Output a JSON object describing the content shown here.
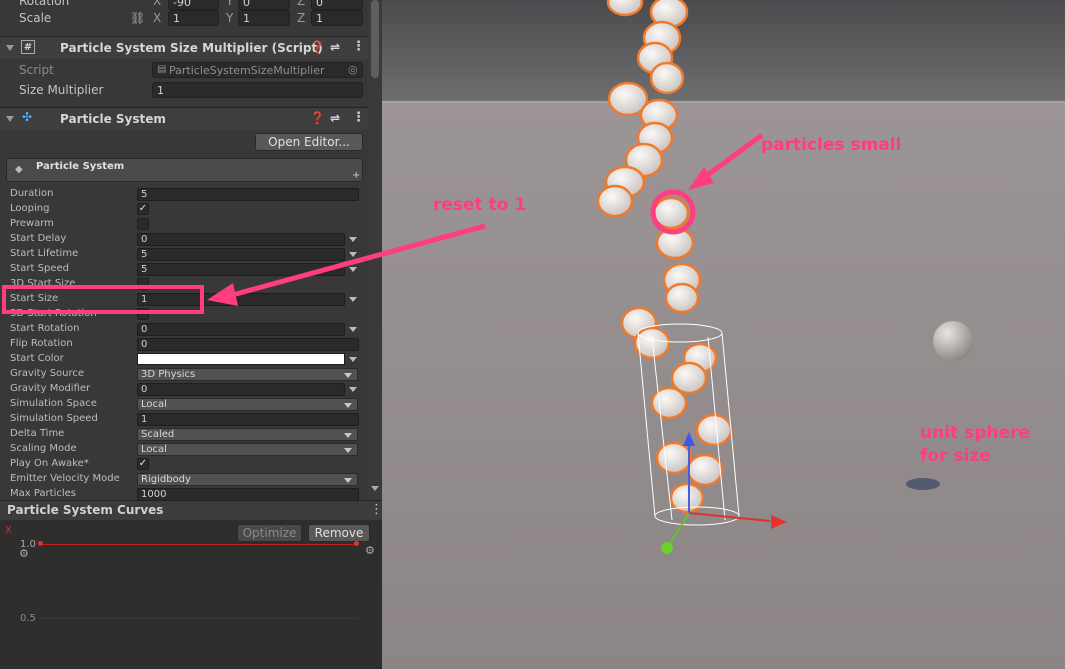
{
  "transform": {
    "rotation_label": "Rotation",
    "rotation_x": "-90",
    "rotation_y": "0",
    "rotation_z": "0",
    "scale_label": "Scale",
    "scale_x": "1",
    "scale_y": "1",
    "scale_z": "1",
    "x": "X",
    "y": "Y",
    "z": "Z"
  },
  "size_script": {
    "title": "Particle System Size Multiplier (Script)",
    "script_label": "Script",
    "script_value": "ParticleSystemSizeMultiplier",
    "multiplier_label": "Size Multiplier",
    "multiplier_value": "1"
  },
  "particle_component": {
    "title": "Particle System",
    "open_editor": "Open Editor...",
    "module_title": "Particle System"
  },
  "props": {
    "duration": {
      "label": "Duration",
      "value": "5"
    },
    "looping": {
      "label": "Looping",
      "value": "✓"
    },
    "prewarm": {
      "label": "Prewarm"
    },
    "start_delay": {
      "label": "Start Delay",
      "value": "0"
    },
    "start_lifetime": {
      "label": "Start Lifetime",
      "value": "5"
    },
    "start_speed": {
      "label": "Start Speed",
      "value": "5"
    },
    "start_size_3d": {
      "label": "3D Start Size"
    },
    "start_size": {
      "label": "Start Size",
      "value": "1"
    },
    "start_rotation_3d": {
      "label": "3D Start Rotation"
    },
    "start_rotation": {
      "label": "Start Rotation",
      "value": "0"
    },
    "flip_rotation": {
      "label": "Flip Rotation",
      "value": "0"
    },
    "start_color": {
      "label": "Start Color"
    },
    "gravity_source": {
      "label": "Gravity Source",
      "value": "3D Physics"
    },
    "gravity_modifier": {
      "label": "Gravity Modifier",
      "value": "0"
    },
    "simulation_space": {
      "label": "Simulation Space",
      "value": "Local"
    },
    "simulation_speed": {
      "label": "Simulation Speed",
      "value": "1"
    },
    "delta_time": {
      "label": "Delta Time",
      "value": "Scaled"
    },
    "scaling_mode": {
      "label": "Scaling Mode",
      "value": "Local"
    },
    "play_on_awake": {
      "label": "Play On Awake*",
      "value": "✓"
    },
    "emitter_velocity_mode": {
      "label": "Emitter Velocity Mode",
      "value": "Rigidbody"
    },
    "max_particles": {
      "label": "Max Particles",
      "value": "1000"
    }
  },
  "curves": {
    "title": "Particle System Curves",
    "optimize": "Optimize",
    "remove": "Remove",
    "axis_x": "X",
    "tick_top": "1.0",
    "tick_mid": "0.5"
  },
  "annotations": {
    "reset": "reset to 1",
    "particles_small": "particles small",
    "unit_sphere_line1": "unit sphere",
    "unit_sphere_line2": "for size"
  },
  "colors": {
    "annotation": "#ff3d7f",
    "selection_outline": "#f07a2c"
  }
}
